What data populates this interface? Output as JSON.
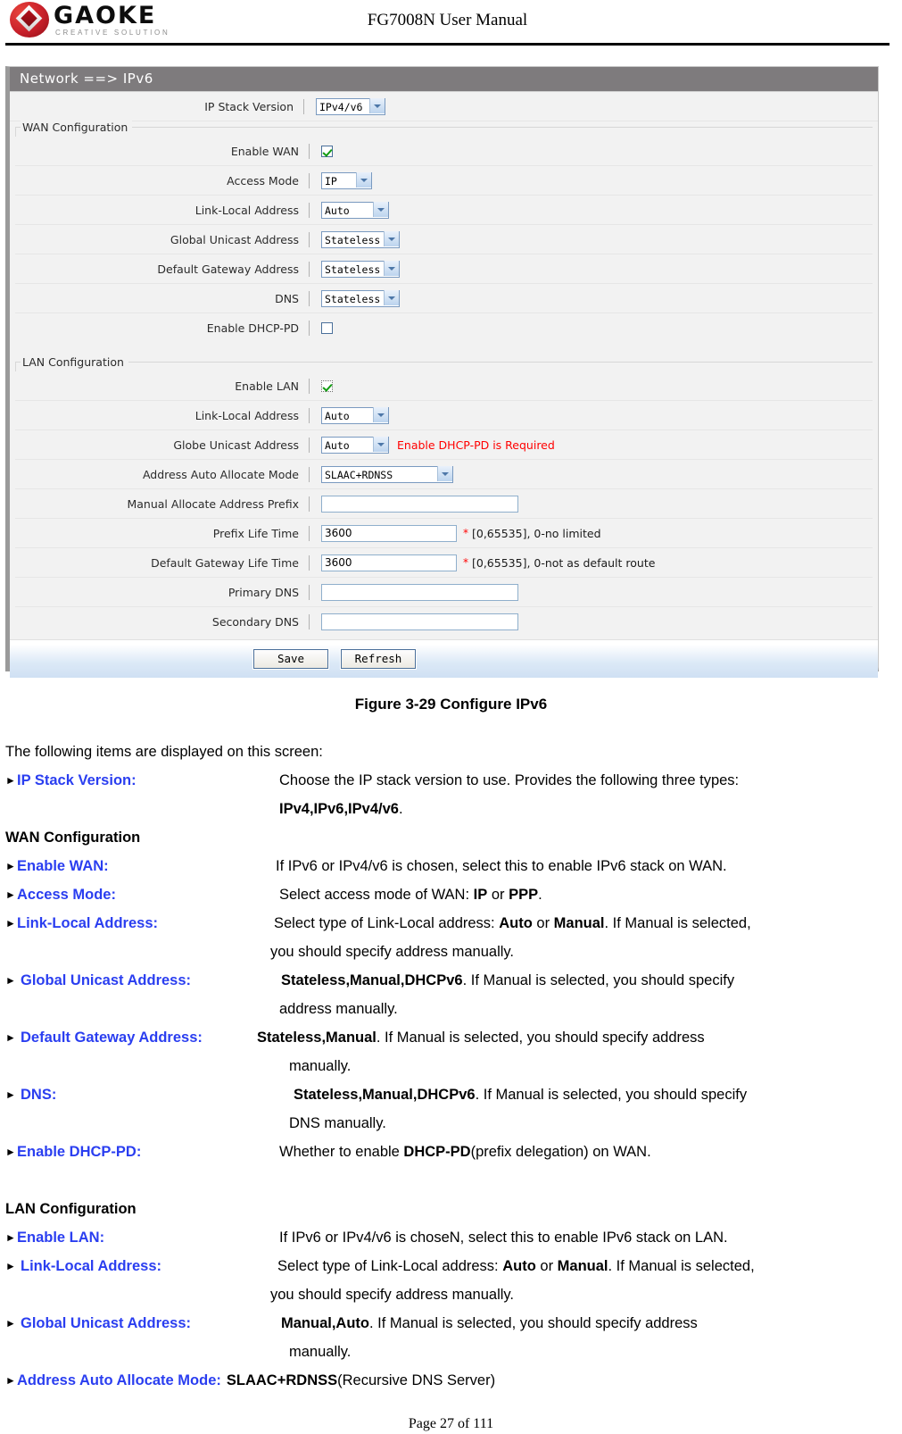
{
  "header": {
    "logo_word": "GAOKE",
    "logo_tagline": "CREATIVE SOLUTION",
    "doc_title": "FG7008N User Manual"
  },
  "router_ui": {
    "breadcrumb_title": "Network ==> IPv6",
    "ip_stack": {
      "label": "IP Stack Version",
      "value": "IPv4/v6",
      "options": [
        "IPv4",
        "IPv6",
        "IPv4/v6"
      ]
    },
    "wan": {
      "legend": "WAN Configuration",
      "enable_wan": {
        "label": "Enable WAN",
        "checked": true
      },
      "access_mode": {
        "label": "Access Mode",
        "value": "IP",
        "options": [
          "IP",
          "PPP"
        ]
      },
      "link_local": {
        "label": "Link-Local Address",
        "value": "Auto",
        "options": [
          "Auto",
          "Manual"
        ]
      },
      "global_unicast": {
        "label": "Global Unicast Address",
        "value": "Stateless",
        "options": [
          "Stateless",
          "Manual",
          "DHCPv6"
        ]
      },
      "default_gateway": {
        "label": "Default Gateway Address",
        "value": "Stateless",
        "options": [
          "Stateless",
          "Manual"
        ]
      },
      "dns": {
        "label": "DNS",
        "value": "Stateless",
        "options": [
          "Stateless",
          "Manual",
          "DHCPv6"
        ]
      },
      "enable_dhcp_pd": {
        "label": "Enable DHCP-PD",
        "checked": false
      }
    },
    "lan": {
      "legend": "LAN Configuration",
      "enable_lan": {
        "label": "Enable LAN",
        "checked": true
      },
      "link_local": {
        "label": "Link-Local Address",
        "value": "Auto",
        "options": [
          "Auto",
          "Manual"
        ]
      },
      "globe_unicast": {
        "label": "Globe Unicast Address",
        "value": "Auto",
        "options": [
          "Auto",
          "Manual"
        ],
        "warning": "Enable DHCP-PD is Required"
      },
      "alloc_mode": {
        "label": "Address Auto Allocate Mode",
        "value": "SLAAC+RDNSS",
        "options": [
          "SLAAC+RDNSS",
          "SLAAC",
          "DHCPv6"
        ]
      },
      "manual_prefix": {
        "label": "Manual Allocate Address Prefix",
        "value": ""
      },
      "prefix_life": {
        "label": "Prefix Life Time",
        "value": "3600",
        "star": "*",
        "note": "[0,65535], 0-no limited"
      },
      "gateway_life": {
        "label": "Default Gateway Life Time",
        "value": "3600",
        "star": "*",
        "note": "[0,65535], 0-not as default route"
      },
      "primary_dns": {
        "label": "Primary DNS",
        "value": ""
      },
      "secondary_dns": {
        "label": "Secondary DNS",
        "value": ""
      }
    },
    "buttons": {
      "save": "Save",
      "refresh": "Refresh"
    }
  },
  "figure": {
    "caption": "Figure 3-29   Configure IPv6"
  },
  "body": {
    "intro": "The following items are displayed on this screen:",
    "ip_stack_version": {
      "term": "IP Stack Version:",
      "desc_line1": "Choose the IP stack version to use. Provides the following three types:",
      "desc_line2_bold": "IPv4,IPv6,IPv4/v6",
      "desc_line2_tail": "."
    },
    "wan_heading": "WAN Configuration",
    "enable_wan": {
      "term": "Enable WAN:",
      "desc": "If IPv6 or IPv4/v6 is chosen, select this to enable IPv6 stack on WAN."
    },
    "access_mode": {
      "term": "Access Mode:",
      "desc_pre": "Select access mode of WAN: ",
      "desc_b1": "IP",
      "desc_mid": " or ",
      "desc_b2": "PPP",
      "desc_tail": "."
    },
    "link_local_wan": {
      "term": "Link-Local Address:",
      "desc_pre": "Select type of Link-Local address: ",
      "desc_b1": "Auto",
      "desc_mid": " or ",
      "desc_b2": "Manual",
      "desc_tail": ". If Manual is selected,",
      "desc_line2": "you should specify address manually."
    },
    "global_unicast_wan": {
      "term": "Global Unicast Address:",
      "desc_b1": "Stateless,Manual,DHCPv6",
      "desc_tail": ". If Manual is selected, you should specify",
      "desc_line2": "address manually."
    },
    "default_gateway_wan": {
      "term": "Default Gateway Address:",
      "desc_b1": "Stateless,Manual",
      "desc_tail": ". If Manual is selected, you should specify address",
      "desc_line2": "manually."
    },
    "dns_wan": {
      "term": "DNS:",
      "desc_b1": "Stateless,Manual,DHCPv6",
      "desc_tail": ". If Manual is selected, you should specify",
      "desc_line2": "DNS manually."
    },
    "enable_dhcp_pd": {
      "term": "Enable DHCP-PD:",
      "desc_pre": "Whether to enable ",
      "desc_b1": "DHCP-PD",
      "desc_tail": "(prefix delegation) on WAN."
    },
    "lan_heading": "LAN Configuration",
    "enable_lan": {
      "term": "Enable LAN:",
      "desc": "If IPv6 or IPv4/v6 is choseN, select this to enable IPv6 stack on LAN."
    },
    "link_local_lan": {
      "term": "Link-Local Address:",
      "desc_pre": "Select type of Link-Local address: ",
      "desc_b1": "Auto",
      "desc_mid": " or ",
      "desc_b2": "Manual",
      "desc_tail": ". If Manual is selected,",
      "desc_line2": "you should specify address manually."
    },
    "global_unicast_lan": {
      "term": "Global  Unicast  Address:",
      "desc_b1": "Manual,Auto",
      "desc_tail": ". If  Manual  is  selected,  you  should  specify  address",
      "desc_line2": "manually."
    },
    "alloc_mode": {
      "term": "Address Auto Allocate Mode:",
      "desc_b1": "SLAAC+RDNSS",
      "desc_tail": "(Recursive DNS Server)"
    }
  },
  "footer": {
    "page": "Page 27 of 111"
  },
  "colors": {
    "term_blue": "#2a3ef0",
    "warning_red": "#ff0000",
    "titlebar_grey": "#7e7b7d",
    "panel_bg": "#f2f2f2"
  }
}
